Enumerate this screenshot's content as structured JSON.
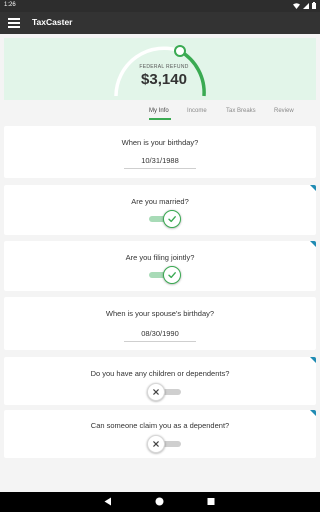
{
  "status_bar": {
    "time": "1:26"
  },
  "app_bar": {
    "title": "TaxCaster"
  },
  "refund": {
    "label": "FEDERAL REFUND",
    "amount": "$3,140"
  },
  "tabs": [
    {
      "label": "My Info",
      "active": true
    },
    {
      "label": "Income",
      "active": false
    },
    {
      "label": "Tax Breaks",
      "active": false
    },
    {
      "label": "Review",
      "active": false
    }
  ],
  "questions": [
    {
      "question": "When is your birthday?",
      "type": "date",
      "value": "10/31/1988"
    },
    {
      "question": "Are you married?",
      "type": "toggle",
      "value": true
    },
    {
      "question": "Are you filing jointly?",
      "type": "toggle",
      "value": true
    },
    {
      "question": "When is your spouse's birthday?",
      "type": "date",
      "value": "08/30/1990"
    },
    {
      "question": "Do you have any children or dependents?",
      "type": "toggle",
      "value": false
    },
    {
      "question": "Can someone claim you as a dependent?",
      "type": "toggle",
      "value": false
    }
  ],
  "colors": {
    "accent_green": "#3aaa52",
    "hero_bg": "#e2f5e9",
    "corner_blue": "#1f8bb3",
    "app_bar": "#333333"
  }
}
